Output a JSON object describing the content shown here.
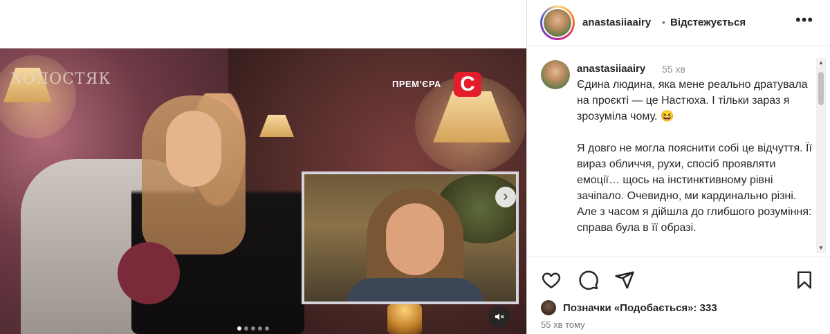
{
  "post": {
    "media": {
      "show_logo_text": "ХОЛОСТЯК",
      "premiere_label": "ПРЕМ'ЄРА",
      "channel_logo_letter": "С",
      "channel_logo_color": "#e31d2c",
      "carousel_total": 5,
      "carousel_active_index": 0
    },
    "header": {
      "username": "anastasiiaairy",
      "separator": "•",
      "follow_status": "Відстежується",
      "more_icon": "more-horizontal-icon"
    },
    "caption": {
      "username": "anastasiiaairy",
      "time": "55 хв",
      "paragraphs": [
        "Єдина людина, яка мене реально дратувала на проєкті — це Настюха. І тільки зараз я зрозуміла чому. 😆",
        "Я довго не могла пояснити собі це відчуття. Її вираз обличчя, рухи, спосіб проявляти емоції… щось на інстинктивному рівні зачіпало. Очевидно, ми кардинально різні. Але з часом я дійшла до глибшого розуміння: справа була в її образі."
      ]
    },
    "actions": {
      "icons": [
        "heart-icon",
        "comment-icon",
        "share-icon",
        "bookmark-icon"
      ],
      "likes_label": "Позначки «Подобається»: 333",
      "posted_ago": "55 хв тому"
    }
  }
}
